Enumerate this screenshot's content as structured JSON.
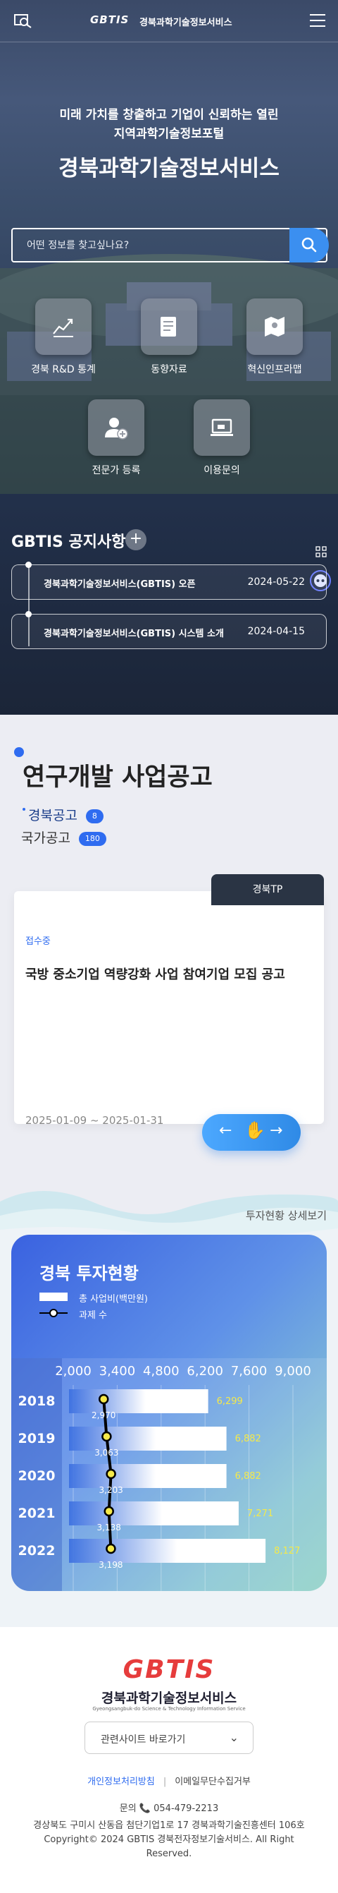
{
  "header": {
    "logo": "GBTIS",
    "logo_sub": "경북과학기술정보서비스"
  },
  "hero": {
    "subtitle_line1": "미래 가치를 창출하고 기업이 신뢰하는 열린",
    "subtitle_line2": "지역과학기술정보포털",
    "title": "경북과학기술정보서비스",
    "search_placeholder": "어떤 정보를 찾고싶나요?"
  },
  "quick_links": [
    {
      "label": "경북 R&D 통계",
      "icon": "chart-icon"
    },
    {
      "label": "동향자료",
      "icon": "document-icon"
    },
    {
      "label": "혁신인프라맵",
      "icon": "map-icon"
    },
    {
      "label": "전문가 등록",
      "icon": "add-user-icon"
    },
    {
      "label": "이용문의",
      "icon": "laptop-icon"
    }
  ],
  "notices": {
    "title": "GBTIS 공지사항",
    "items": [
      {
        "title": "경북과학기술정보서비스(GBTIS) 오픈",
        "date": "2024-05-22"
      },
      {
        "title": "경북과학기술정보서비스(GBTIS) 시스템 소개",
        "date": "2024-04-15"
      }
    ]
  },
  "rnd": {
    "title": "연구개발 사업공고",
    "tabs": [
      {
        "label": "경북공고",
        "count": "8",
        "active": true
      },
      {
        "label": "국가공고",
        "count": "180",
        "active": false
      }
    ],
    "card": {
      "tag": "경북TP",
      "status": "접수중",
      "title": "국방 중소기업 역량강화 사업 참여기업 모집 공고",
      "date": "2025-01-09 ~ 2025-01-31"
    }
  },
  "investment": {
    "link": "투자현황 상세보기",
    "title": "경북 투자현황",
    "legend_amount": "총 사업비(백만원)",
    "legend_count": "과제 수",
    "colors": {
      "bar": "#ffffff",
      "amount_label": "#f5e94a",
      "count_label": "#ffffff"
    }
  },
  "chart_data": {
    "type": "bar",
    "orientation": "horizontal",
    "categories": [
      "2018",
      "2019",
      "2020",
      "2021",
      "2022"
    ],
    "x_ticks": [
      "2,000",
      "3,400",
      "4,800",
      "6,200",
      "7,600",
      "9,000"
    ],
    "xlim": [
      2000,
      9000
    ],
    "series": [
      {
        "name": "총 사업비(백만원)",
        "type": "bar",
        "values": [
          6299,
          6882,
          6882,
          7271,
          8127
        ],
        "labels": [
          "6,299",
          "6,882",
          "6,882",
          "7,271",
          "8,127"
        ]
      },
      {
        "name": "과제 수",
        "type": "line",
        "values": [
          2970,
          3063,
          3203,
          3138,
          3198
        ],
        "labels": [
          "2,970",
          "3,063",
          "3,203",
          "3,138",
          "3,198"
        ]
      }
    ]
  },
  "footer": {
    "logo": "GBTIS",
    "name": "경북과학기술정보서비스",
    "english": "Gyeongsangbuk-do Science & Technology Information Service",
    "select_label": "관련사이트 바로가기",
    "privacy": "개인정보처리방침",
    "email_policy": "이메일무단수집거부",
    "tel": "문의 📞 054-479-2213",
    "address": "경상북도 구미시 산동읍 첨단기업1로 17 경북과학기술진흥센터 106호",
    "copyright": "Copyright© 2024 GBTIS 경북전자정보기술서비스. All Right Reserved."
  }
}
